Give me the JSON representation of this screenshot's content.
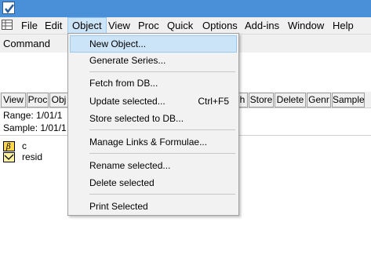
{
  "menubar": {
    "items": [
      "File",
      "Edit",
      "Object",
      "View",
      "Proc",
      "Quick",
      "Options",
      "Add-ins",
      "Window",
      "Help"
    ],
    "active_index": 2
  },
  "command": {
    "label": "Command"
  },
  "workfile": {
    "toolbar": [
      "View",
      "Proc",
      "Obj",
      "h",
      "Store",
      "Delete",
      "Genr",
      "Sample"
    ],
    "range": "Range:   1/01/1",
    "sample": "Sample: 1/01/1",
    "objects": [
      {
        "name": "c",
        "icon": "coefficient-icon"
      },
      {
        "name": "resid",
        "icon": "series-icon"
      }
    ]
  },
  "object_menu": {
    "items": [
      {
        "label": "New Object...",
        "shortcut": "",
        "highlighted": true
      },
      {
        "label": "Generate Series...",
        "shortcut": ""
      },
      {
        "label": "Fetch from DB...",
        "shortcut": ""
      },
      {
        "label": "Update selected...",
        "shortcut": "Ctrl+F5"
      },
      {
        "label": "Store selected to DB...",
        "shortcut": ""
      },
      {
        "label": "Manage Links & Formulae...",
        "shortcut": ""
      },
      {
        "label": "Rename selected...",
        "shortcut": ""
      },
      {
        "label": "Delete selected",
        "shortcut": ""
      },
      {
        "label": "Print Selected",
        "shortcut": ""
      }
    ]
  },
  "colors": {
    "titlebar": "#4a90d9",
    "menubar": "#f0f0f0",
    "highlight": "#cce4f7",
    "highlight_border": "#99c9ef"
  }
}
